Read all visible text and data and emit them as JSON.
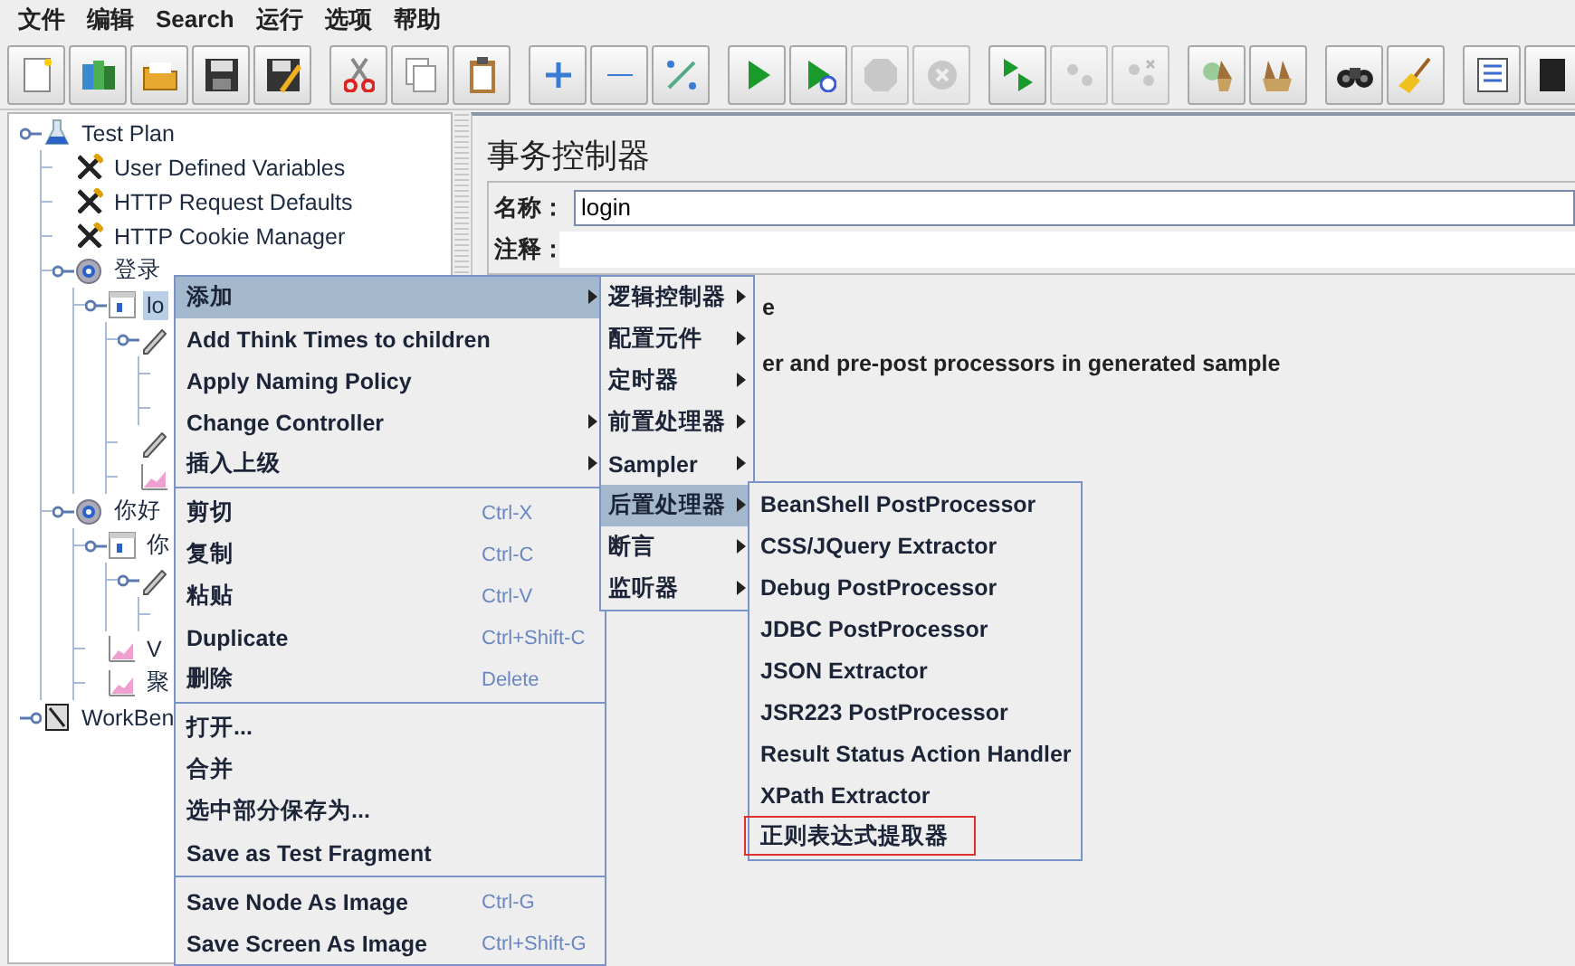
{
  "menubar": [
    "文件",
    "编辑",
    "Search",
    "运行",
    "选项",
    "帮助"
  ],
  "toolbar": [
    [
      {
        "kind": "new",
        "disabled": false
      },
      {
        "kind": "templates",
        "disabled": false
      },
      {
        "kind": "open",
        "disabled": false
      },
      {
        "kind": "save",
        "disabled": false
      },
      {
        "kind": "saveas",
        "disabled": false
      }
    ],
    [
      {
        "kind": "cut",
        "disabled": false
      },
      {
        "kind": "copy",
        "disabled": false
      },
      {
        "kind": "paste",
        "disabled": false
      }
    ],
    [
      {
        "kind": "expand",
        "disabled": false
      },
      {
        "kind": "collapse",
        "disabled": false
      },
      {
        "kind": "toggle",
        "disabled": false
      }
    ],
    [
      {
        "kind": "start",
        "disabled": false
      },
      {
        "kind": "startnp",
        "disabled": false
      },
      {
        "kind": "stop",
        "disabled": true
      },
      {
        "kind": "shutdown",
        "disabled": true
      }
    ],
    [
      {
        "kind": "rstart",
        "disabled": false
      },
      {
        "kind": "rstop",
        "disabled": true
      },
      {
        "kind": "rshut",
        "disabled": true
      }
    ],
    [
      {
        "kind": "clear",
        "disabled": false
      },
      {
        "kind": "clearall",
        "disabled": false
      }
    ],
    [
      {
        "kind": "search",
        "disabled": false
      },
      {
        "kind": "reset",
        "disabled": false
      }
    ],
    [
      {
        "kind": "func",
        "disabled": false
      },
      {
        "kind": "book",
        "disabled": false
      }
    ]
  ],
  "tree": [
    {
      "kind": "testplan",
      "label": "Test Plan",
      "expanded": true,
      "selected": false,
      "children": [
        {
          "kind": "config",
          "label": "User Defined Variables",
          "selected": false
        },
        {
          "kind": "config",
          "label": "HTTP Request Defaults",
          "selected": false
        },
        {
          "kind": "config",
          "label": "HTTP Cookie Manager",
          "selected": false
        },
        {
          "kind": "threadgroup",
          "label": "登录",
          "expanded": true,
          "selected": false,
          "children": [
            {
              "kind": "controller",
              "label": "lo",
              "expanded": true,
              "selected": true,
              "children": [
                {
                  "kind": "sampler",
                  "expanded": true,
                  "children": [
                    {
                      "kind": "covered"
                    },
                    {
                      "kind": "covered"
                    }
                  ]
                },
                {
                  "kind": "sampler"
                },
                {
                  "kind": "listener"
                }
              ]
            }
          ]
        },
        {
          "kind": "threadgroup",
          "label": "你好",
          "expanded": true,
          "selected": false,
          "children": [
            {
              "kind": "controller",
              "label": "你",
              "expanded": true,
              "selected": false,
              "children": [
                {
                  "kind": "sampler",
                  "expanded": true,
                  "children": [
                    {
                      "kind": "covered"
                    }
                  ]
                }
              ]
            },
            {
              "kind": "listener",
              "label": "V",
              "selected": false
            },
            {
              "kind": "listener",
              "label": "聚",
              "selected": false
            }
          ]
        }
      ]
    },
    {
      "kind": "workbench",
      "label": "WorkBen",
      "expanded": false,
      "selected": false
    }
  ],
  "editor": {
    "title": "事务控制器",
    "fields": [
      {
        "label": "名称：",
        "value": "login"
      },
      {
        "label": "注释："
      }
    ],
    "options": [
      "e",
      "er and pre-post processors in generated sample"
    ]
  },
  "context_menu": [
    [
      {
        "label": "添加",
        "submenu": true,
        "selected": true
      },
      {
        "label": "Add Think Times to children",
        "submenu": false,
        "selected": false
      },
      {
        "label": "Apply Naming Policy",
        "submenu": false,
        "selected": false
      },
      {
        "label": "Change Controller",
        "submenu": true,
        "selected": false
      },
      {
        "label": "插入上级",
        "submenu": true,
        "selected": false
      }
    ],
    [
      {
        "label": "剪切",
        "shortcut": "Ctrl-X",
        "submenu": false,
        "selected": false
      },
      {
        "label": "复制",
        "shortcut": "Ctrl-C",
        "submenu": false,
        "selected": false
      },
      {
        "label": "粘贴",
        "shortcut": "Ctrl-V",
        "submenu": false,
        "selected": false
      },
      {
        "label": "Duplicate",
        "shortcut": "Ctrl+Shift-C",
        "submenu": false,
        "selected": false
      },
      {
        "label": "删除",
        "shortcut": "Delete",
        "submenu": false,
        "selected": false
      }
    ],
    [
      {
        "label": "打开...",
        "submenu": false,
        "selected": false
      },
      {
        "label": "合并",
        "submenu": false,
        "selected": false
      },
      {
        "label": "选中部分保存为...",
        "submenu": false,
        "selected": false
      },
      {
        "label": "Save as Test Fragment",
        "submenu": false,
        "selected": false
      }
    ],
    [
      {
        "label": "Save Node As Image",
        "shortcut": "Ctrl-G",
        "submenu": false,
        "selected": false
      },
      {
        "label": "Save Screen As Image",
        "shortcut": "Ctrl+Shift-G",
        "submenu": false,
        "selected": false
      }
    ]
  ],
  "add_submenu": [
    {
      "label": "逻辑控制器",
      "selected": false
    },
    {
      "label": "配置元件",
      "selected": false
    },
    {
      "label": "定时器",
      "selected": false
    },
    {
      "label": "前置处理器",
      "selected": false
    },
    {
      "label": "Sampler",
      "selected": false
    },
    {
      "label": "后置处理器",
      "selected": true
    },
    {
      "label": "断言",
      "selected": false
    },
    {
      "label": "监听器",
      "selected": false
    }
  ],
  "postprocessor_submenu": [
    {
      "label": "BeanShell PostProcessor",
      "marked": false
    },
    {
      "label": "CSS/JQuery Extractor",
      "marked": false
    },
    {
      "label": "Debug PostProcessor",
      "marked": false
    },
    {
      "label": "JDBC PostProcessor",
      "marked": false
    },
    {
      "label": "JSON Extractor",
      "marked": false
    },
    {
      "label": "JSR223 PostProcessor",
      "marked": false
    },
    {
      "label": "Result Status Action Handler",
      "marked": false
    },
    {
      "label": "XPath Extractor",
      "marked": false
    },
    {
      "label": "正则表达式提取器",
      "marked": true
    }
  ]
}
